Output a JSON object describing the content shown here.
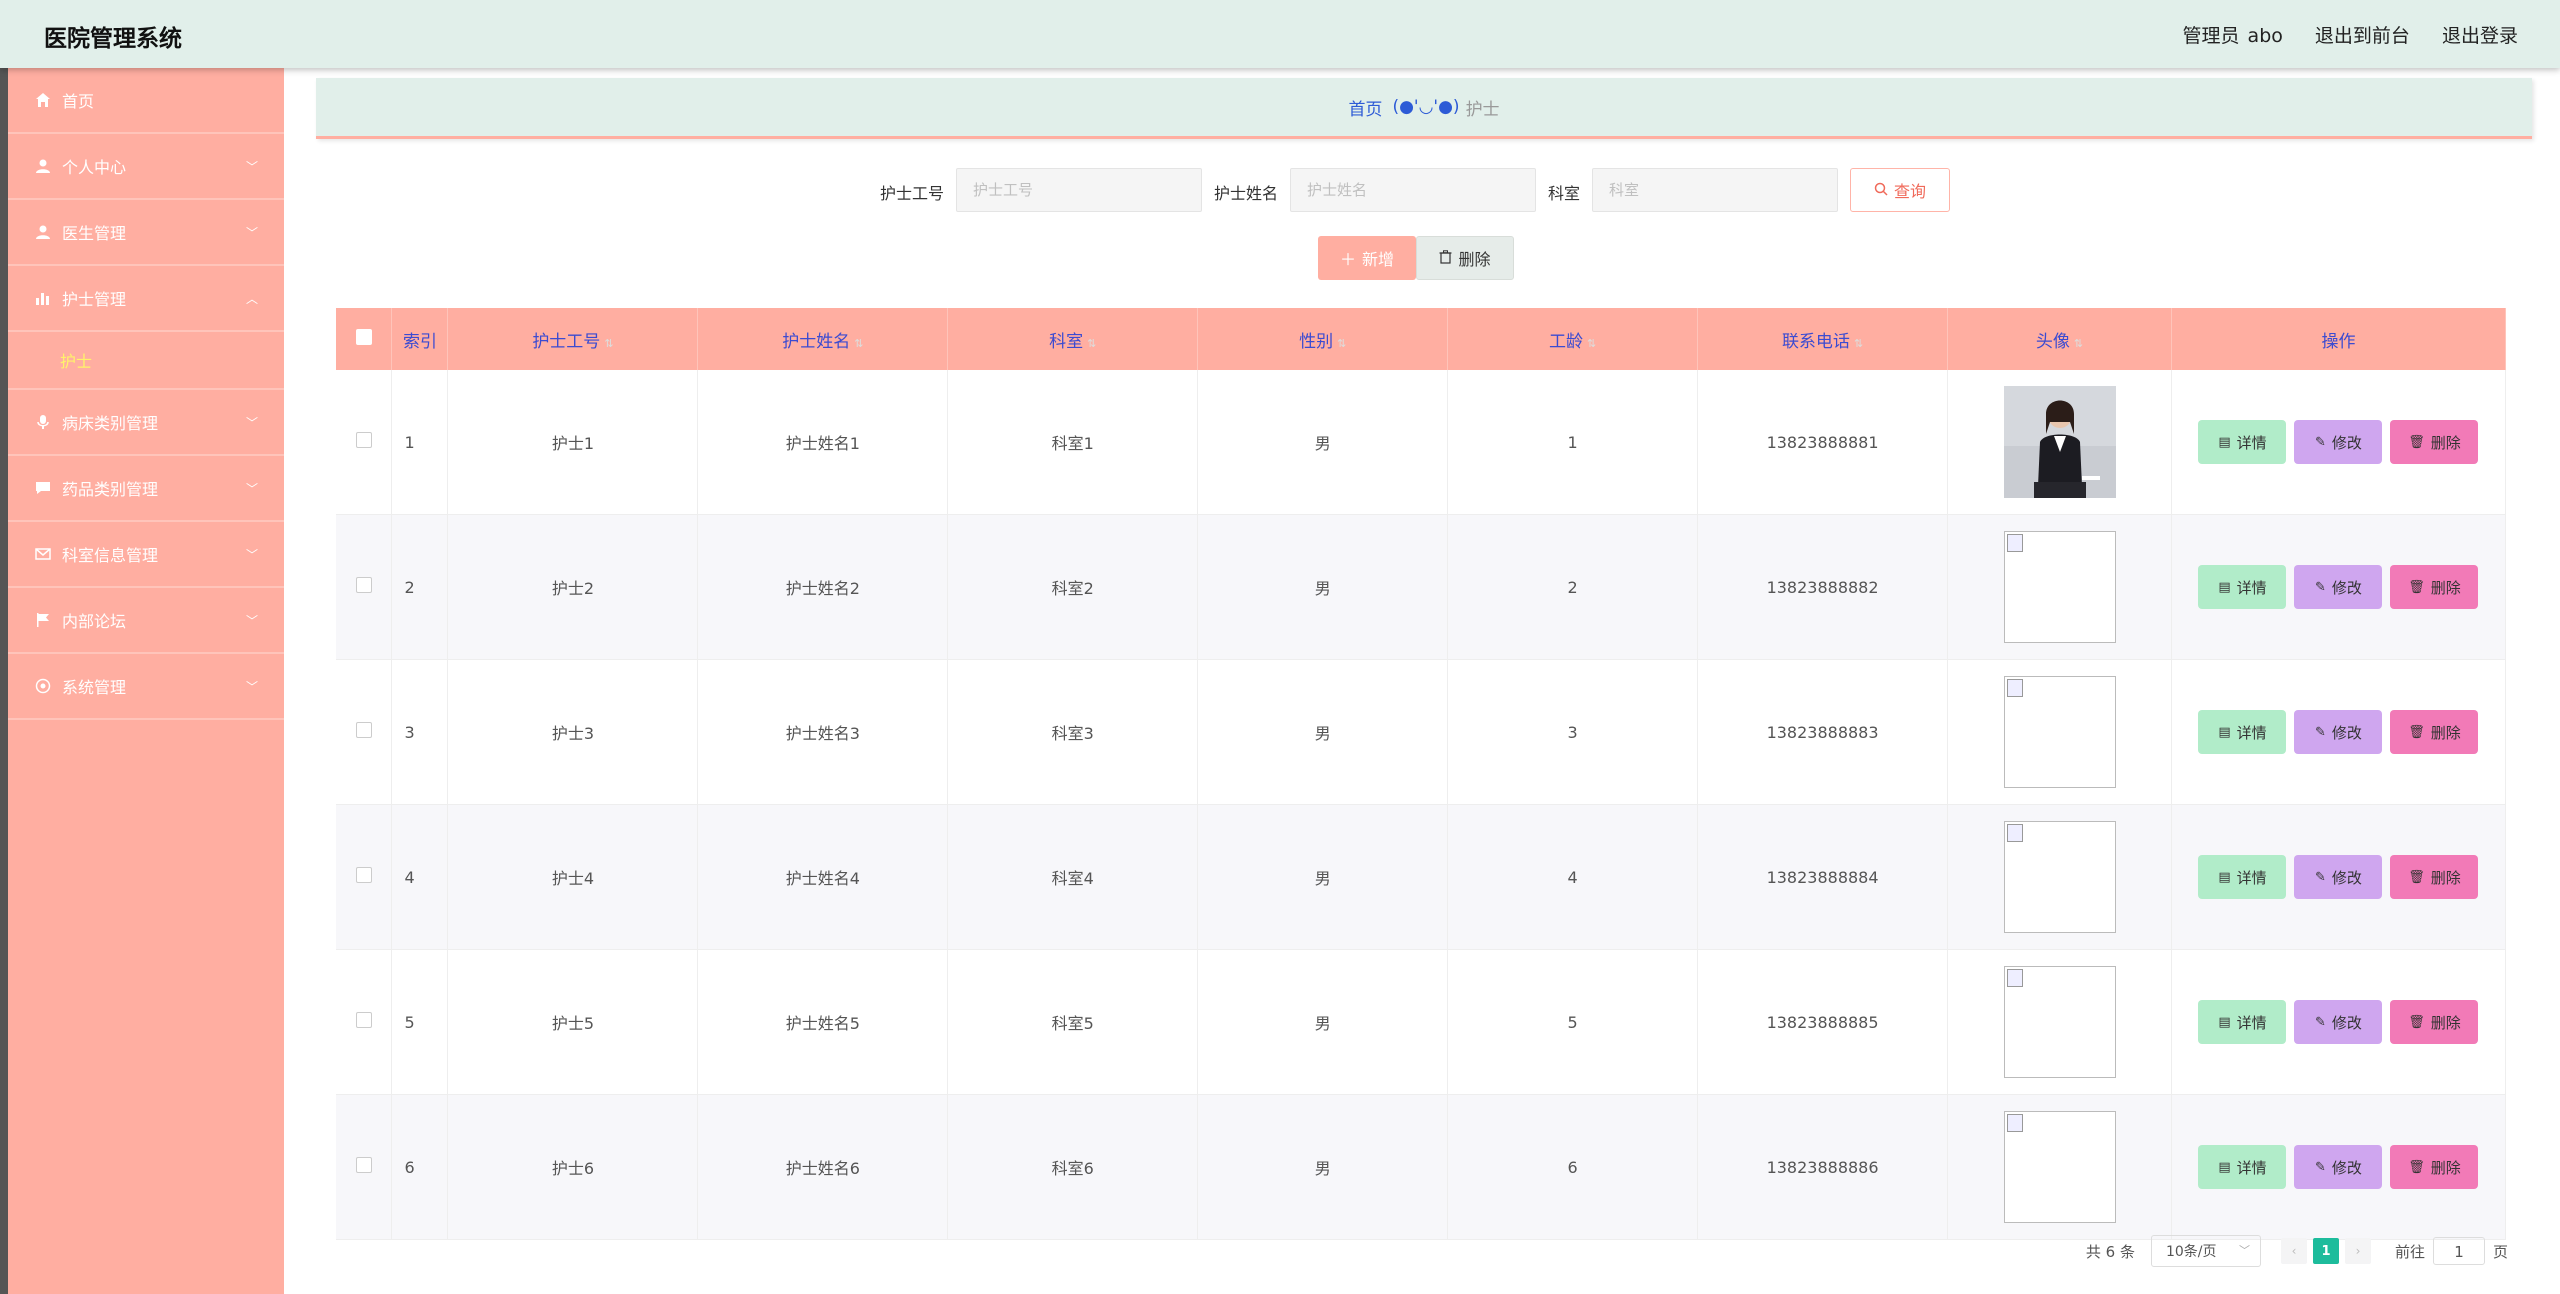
{
  "app": {
    "title": "医院管理系统"
  },
  "topbar": {
    "admin_label": "管理员",
    "admin_name": "abo",
    "to_front": "退出到前台",
    "logout": "退出登录"
  },
  "sidebar": {
    "items": [
      {
        "label": "首页",
        "icon": "home-icon"
      },
      {
        "label": "个人中心",
        "icon": "user-icon"
      },
      {
        "label": "医生管理",
        "icon": "user-icon"
      },
      {
        "label": "护士管理",
        "icon": "bar-chart-icon",
        "expanded": true,
        "children": [
          {
            "label": "护士"
          }
        ]
      },
      {
        "label": "病床类别管理",
        "icon": "microphone-icon"
      },
      {
        "label": "药品类别管理",
        "icon": "chat-icon"
      },
      {
        "label": "科室信息管理",
        "icon": "mail-icon"
      },
      {
        "label": "内部论坛",
        "icon": "flag-icon"
      },
      {
        "label": "系统管理",
        "icon": "settings-icon"
      }
    ]
  },
  "breadcrumb": {
    "home": "首页",
    "face": "(●'◡'●)",
    "current": "护士"
  },
  "search": {
    "nurse_no_label": "护士工号",
    "nurse_no_placeholder": "护士工号",
    "nurse_name_label": "护士姓名",
    "nurse_name_placeholder": "护士姓名",
    "dept_label": "科室",
    "dept_placeholder": "科室",
    "query_button": "查询"
  },
  "actions": {
    "add": "新增",
    "delete": "删除"
  },
  "table": {
    "columns": [
      "索引",
      "护士工号",
      "护士姓名",
      "科室",
      "性别",
      "工龄",
      "联系电话",
      "头像",
      "操作"
    ],
    "rows": [
      {
        "index": "1",
        "no": "护士1",
        "name": "护士姓名1",
        "dept": "科室1",
        "gender": "男",
        "years": "1",
        "phone": "13823888881",
        "avatar": "photo"
      },
      {
        "index": "2",
        "no": "护士2",
        "name": "护士姓名2",
        "dept": "科室2",
        "gender": "男",
        "years": "2",
        "phone": "13823888882",
        "avatar": "broken"
      },
      {
        "index": "3",
        "no": "护士3",
        "name": "护士姓名3",
        "dept": "科室3",
        "gender": "男",
        "years": "3",
        "phone": "13823888883",
        "avatar": "broken"
      },
      {
        "index": "4",
        "no": "护士4",
        "name": "护士姓名4",
        "dept": "科室4",
        "gender": "男",
        "years": "4",
        "phone": "13823888884",
        "avatar": "broken"
      },
      {
        "index": "5",
        "no": "护士5",
        "name": "护士姓名5",
        "dept": "科室5",
        "gender": "男",
        "years": "5",
        "phone": "13823888885",
        "avatar": "broken"
      },
      {
        "index": "6",
        "no": "护士6",
        "name": "护士姓名6",
        "dept": "科室6",
        "gender": "男",
        "years": "6",
        "phone": "13823888886",
        "avatar": "broken"
      }
    ],
    "row_actions": {
      "detail": "详情",
      "edit": "修改",
      "delete": "删除"
    }
  },
  "pager": {
    "total": "共 6 条",
    "page_size": "10条/页",
    "current_page": "1",
    "goto_label": "前往",
    "goto_value": "1",
    "page_suffix": "页"
  },
  "colors": {
    "sidebar": "#ffaea1",
    "topbar": "#e1efea",
    "active_submenu": "#fff36a",
    "pager_active": "#1dbc9c"
  }
}
